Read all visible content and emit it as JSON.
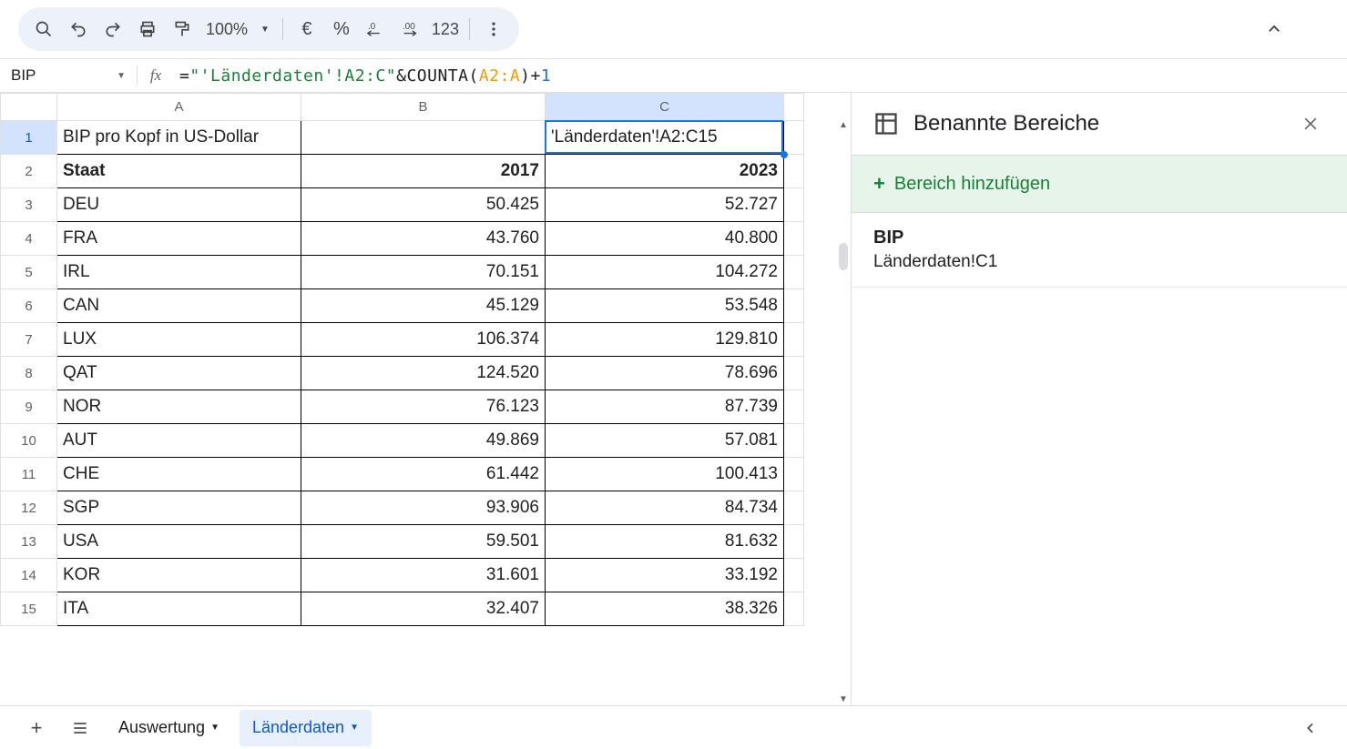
{
  "toolbar": {
    "zoom": "100%",
    "currency": "€",
    "percent": "%",
    "numfmt": "123"
  },
  "namebox": "BIP",
  "formula": {
    "str": "\"'Länderdaten'!A2:C\"",
    "fn": "COUNTA",
    "ref": "A2:A",
    "num": "1"
  },
  "columns": [
    "A",
    "B",
    "C"
  ],
  "selected_col": "C",
  "selected_row": "1",
  "selected_cell_value": "'Länderdaten'!A2:C15",
  "title_cell": "BIP pro Kopf in US-Dollar",
  "headers": {
    "a": "Staat",
    "b": "2017",
    "c": "2023"
  },
  "rows": [
    {
      "a": "DEU",
      "b": "50.425",
      "c": "52.727"
    },
    {
      "a": "FRA",
      "b": "43.760",
      "c": "40.800"
    },
    {
      "a": "IRL",
      "b": "70.151",
      "c": "104.272"
    },
    {
      "a": "CAN",
      "b": "45.129",
      "c": "53.548"
    },
    {
      "a": "LUX",
      "b": "106.374",
      "c": "129.810"
    },
    {
      "a": "QAT",
      "b": "124.520",
      "c": "78.696"
    },
    {
      "a": "NOR",
      "b": "76.123",
      "c": "87.739"
    },
    {
      "a": "AUT",
      "b": "49.869",
      "c": "57.081"
    },
    {
      "a": "CHE",
      "b": "61.442",
      "c": "100.413"
    },
    {
      "a": "SGP",
      "b": "93.906",
      "c": "84.734"
    },
    {
      "a": "USA",
      "b": "59.501",
      "c": "81.632"
    },
    {
      "a": "KOR",
      "b": "31.601",
      "c": "33.192"
    },
    {
      "a": "ITA",
      "b": "32.407",
      "c": "38.326"
    }
  ],
  "sheets": {
    "tab1": "Auswertung",
    "tab2": "Länderdaten"
  },
  "sidepanel": {
    "title": "Benannte Bereiche",
    "add": "Bereich hinzufügen",
    "item": {
      "name": "BIP",
      "range": "Länderdaten!C1"
    }
  }
}
